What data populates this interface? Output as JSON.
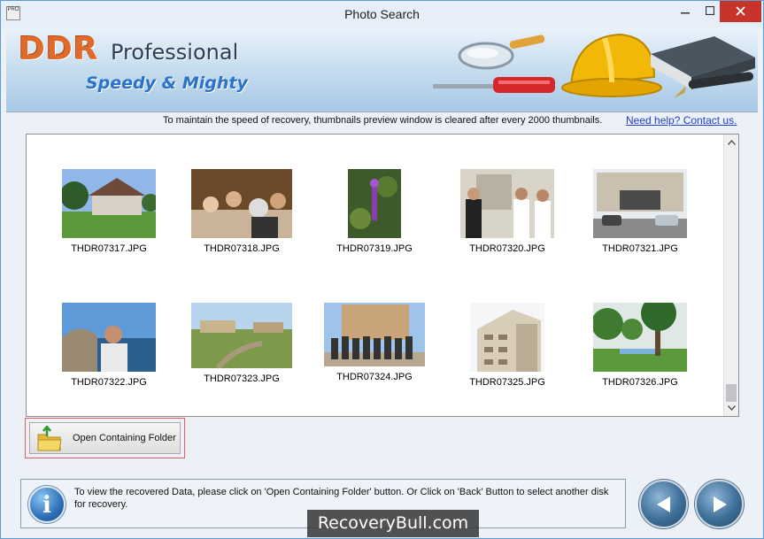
{
  "window": {
    "title": "Photo Search",
    "app_icon_text": "PRO",
    "minimize_icon": "minimize-icon",
    "maximize_icon": "maximize-icon",
    "close_icon": "close-icon"
  },
  "banner": {
    "brand_primary": "DDR",
    "brand_secondary": "Professional",
    "tagline": "Speedy & Mighty",
    "art_icons": [
      "magnifier-icon",
      "screwdriver-icon",
      "hard-hat-icon",
      "book-icon",
      "pen-icon"
    ]
  },
  "notice": {
    "text": "To maintain the speed of recovery, thumbnails preview window is cleared after every 2000 thumbnails.",
    "help_link": "Need help? Contact us."
  },
  "thumbnails": [
    {
      "name": "THDR07317.JPG"
    },
    {
      "name": "THDR07318.JPG"
    },
    {
      "name": "THDR07319.JPG"
    },
    {
      "name": "THDR07320.JPG"
    },
    {
      "name": "THDR07321.JPG"
    },
    {
      "name": "THDR07322.JPG"
    },
    {
      "name": "THDR07323.JPG"
    },
    {
      "name": "THDR07324.JPG"
    },
    {
      "name": "THDR07325.JPG"
    },
    {
      "name": "THDR07326.JPG"
    }
  ],
  "actions": {
    "open_folder_label": "Open Containing Folder"
  },
  "footer": {
    "info_glyph": "i",
    "message": "To view the recovered Data, please click on 'Open Containing Folder' button. Or Click on 'Back' Button to select another disk for recovery.",
    "back_icon": "back-arrow-icon",
    "next_icon": "next-arrow-icon"
  },
  "watermark": "RecoveryBull.com",
  "colors": {
    "brand_orange": "#e06a2c",
    "tagline_blue": "#2a73c8",
    "link_blue": "#1f3fd1",
    "close_red": "#c7342b",
    "highlight_border": "#e05b6b"
  }
}
